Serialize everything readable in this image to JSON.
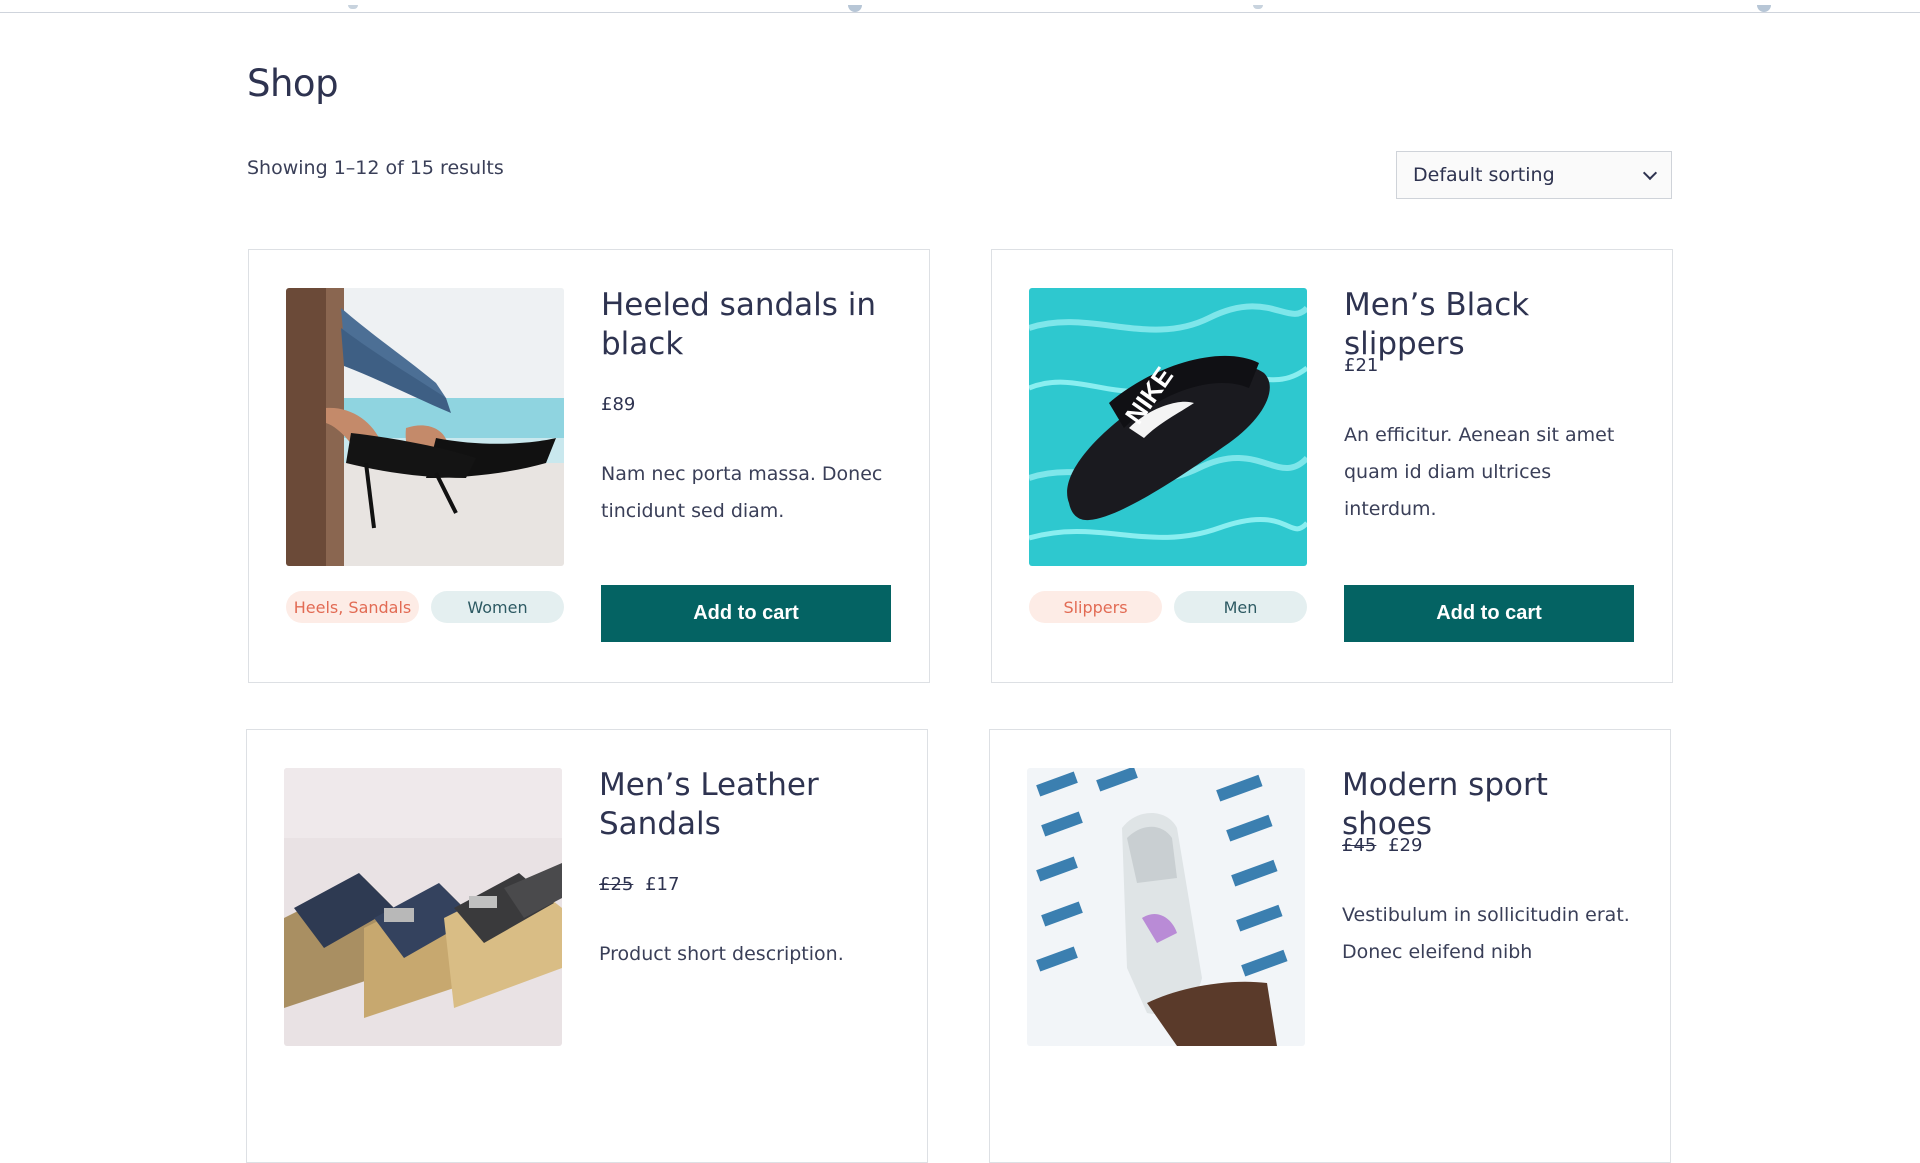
{
  "page": {
    "title": "Shop"
  },
  "toolbar": {
    "result_count": "Showing 1–12 of 15 results",
    "sort": {
      "selected": "Default sorting"
    }
  },
  "products": [
    {
      "title": "Heeled sandals in black",
      "price": "£89",
      "description": "Nam nec porta massa. Donec tincidunt sed diam.",
      "category_tag": "Heels, Sandals",
      "gender_tag": "Women",
      "button_label": "Add to cart"
    },
    {
      "title": "Men’s Black slippers",
      "price": "£21",
      "description": "An efficitur. Aenean sit amet quam id diam ultrices interdum.",
      "category_tag": "Slippers",
      "gender_tag": "Men",
      "button_label": "Add to cart"
    },
    {
      "title": "Men’s Leather Sandals",
      "old_price": "£25",
      "price": "£17",
      "description": "Product short description."
    },
    {
      "title": "Modern sport shoes",
      "old_price": "£45",
      "price": "£29",
      "description": "Vestibulum in sollicitudin erat. Donec eleifend nibh"
    }
  ],
  "colors": {
    "accent_button": "#046363",
    "category_tag_bg": "#fdece6",
    "category_tag_text": "#e26b54",
    "gender_tag_bg": "#e4eff0",
    "gender_tag_text": "#2d5a63",
    "heading_text": "#2e3350"
  }
}
